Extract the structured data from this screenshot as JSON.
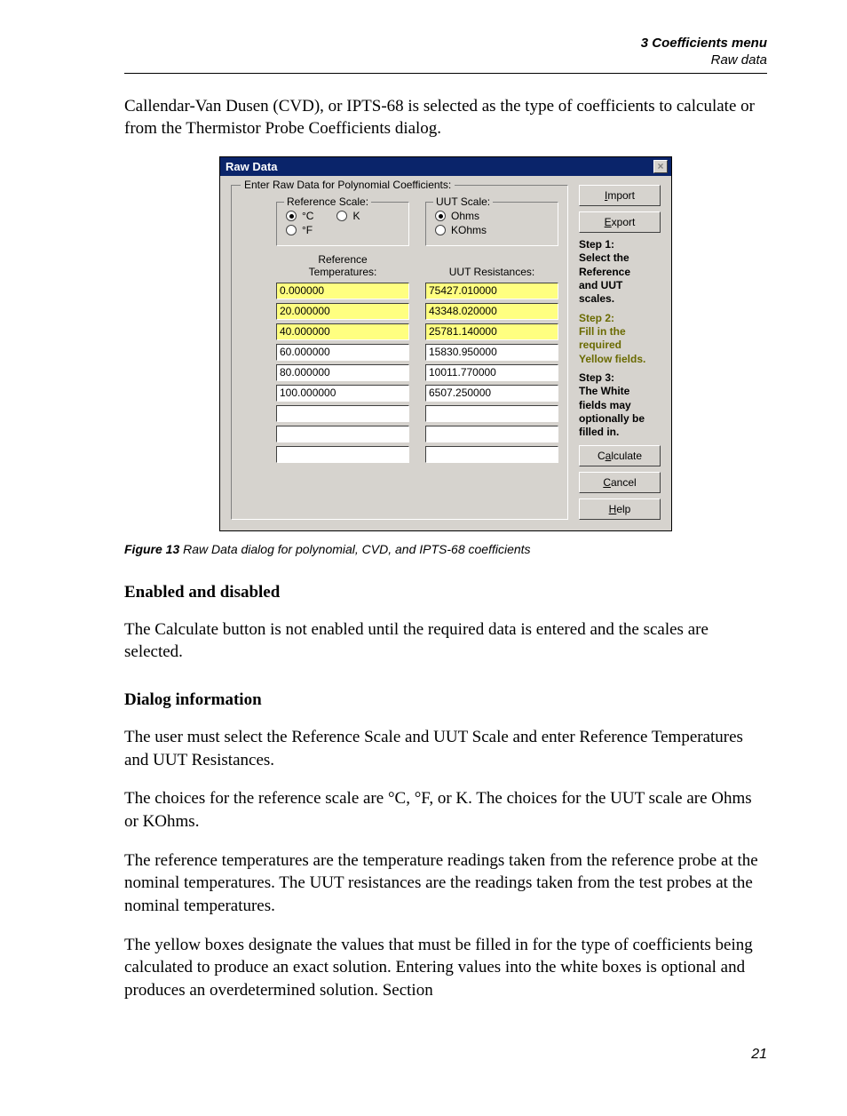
{
  "header": {
    "chapter": "3  Coefficients menu",
    "section": "Raw data"
  },
  "intro": "Callendar-Van Dusen (CVD), or IPTS-68 is selected as the type of coefficients to calculate or from the Thermistor Probe Coefficients dialog.",
  "dialog": {
    "title": "Raw Data",
    "fieldset_legend": "Enter Raw Data for Polynomial Coefficients:",
    "reference_scale": {
      "title": "Reference Scale:",
      "options": {
        "c": "°C",
        "k": "K",
        "f": "°F"
      },
      "selected": "c"
    },
    "uut_scale": {
      "title": "UUT Scale:",
      "options": {
        "ohms": "Ohms",
        "kohms": "KOhms"
      },
      "selected": "ohms"
    },
    "ref_temps": {
      "caption_line1": "Reference",
      "caption_line2": "Temperatures:",
      "values": [
        "0.000000",
        "20.000000",
        "40.000000",
        "60.000000",
        "80.000000",
        "100.000000",
        "",
        "",
        ""
      ]
    },
    "uut_res": {
      "caption": "UUT Resistances:",
      "values": [
        "75427.010000",
        "43348.020000",
        "25781.140000",
        "15830.950000",
        "10011.770000",
        "6507.250000",
        "",
        "",
        ""
      ]
    },
    "side": {
      "import": "Import",
      "export": "Export",
      "step1": "Step 1:\nSelect the\nReference\nand UUT\nscales.",
      "step2": "Step 2:\nFill in the\nrequired\nYellow fields.",
      "step3": "Step 3:\nThe White\nfields may\noptionally be\nfilled in.",
      "calculate": "Calculate",
      "cancel": "Cancel",
      "help": "Help"
    }
  },
  "figure_caption": {
    "bold": "Figure 13",
    "rest": "   Raw Data dialog for polynomial, CVD,  and IPTS-68 coefficients"
  },
  "sections": {
    "enabled_heading": "Enabled and disabled",
    "enabled_text": "The Calculate button is not enabled until the required data is entered and the scales are selected.",
    "dlginfo_heading": "Dialog information",
    "dlginfo_p1": "The user must select the Reference Scale and UUT Scale and enter Reference Temperatures and UUT Resistances.",
    "dlginfo_p2": "The choices for the reference scale are °C, °F, or K. The choices for the UUT scale are Ohms or KOhms.",
    "dlginfo_p3": "The reference temperatures are the temperature readings taken from the reference probe at the nominal temperatures. The UUT resistances are the readings taken from the test probes at the nominal temperatures.",
    "dlginfo_p4": "The yellow boxes designate the values that must be filled in for the type of coefficients being calculated to produce an exact solution. Entering values into the white boxes is optional and produces an overdetermined solution. Section"
  },
  "page_number": "21"
}
